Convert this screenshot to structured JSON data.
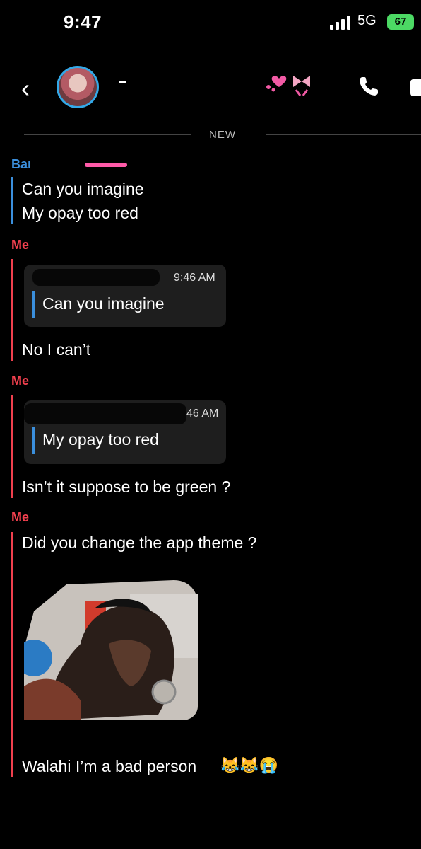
{
  "status_bar": {
    "time": "9:47",
    "network": "5G",
    "battery": "67"
  },
  "header": {
    "contact_name": ""
  },
  "divider": {
    "label": "NEW"
  },
  "messages": [
    {
      "sender": "Baı",
      "lines": [
        "Can you imagine",
        "My opay too red"
      ]
    },
    {
      "sender": "Me",
      "quote_time": "9:46 AM",
      "quote_text": "Can you imagine",
      "text": "No I can’t"
    },
    {
      "sender": "Me",
      "quote_time": "46 AM",
      "quote_text": "My opay too red",
      "text": "Isn’t it suppose to be green ?"
    },
    {
      "sender": "Me",
      "text": "Did you change the app theme ?",
      "final_text": "Walahi I’m a bad person",
      "emojis": "😹😹😭"
    }
  ],
  "colors": {
    "me": "#f0404e",
    "them": "#3b8fdc",
    "background": "#000000"
  },
  "icons": [
    "back-chevron-icon",
    "avatar",
    "phone-icon",
    "video-icon",
    "signal-icon",
    "battery-icon"
  ]
}
